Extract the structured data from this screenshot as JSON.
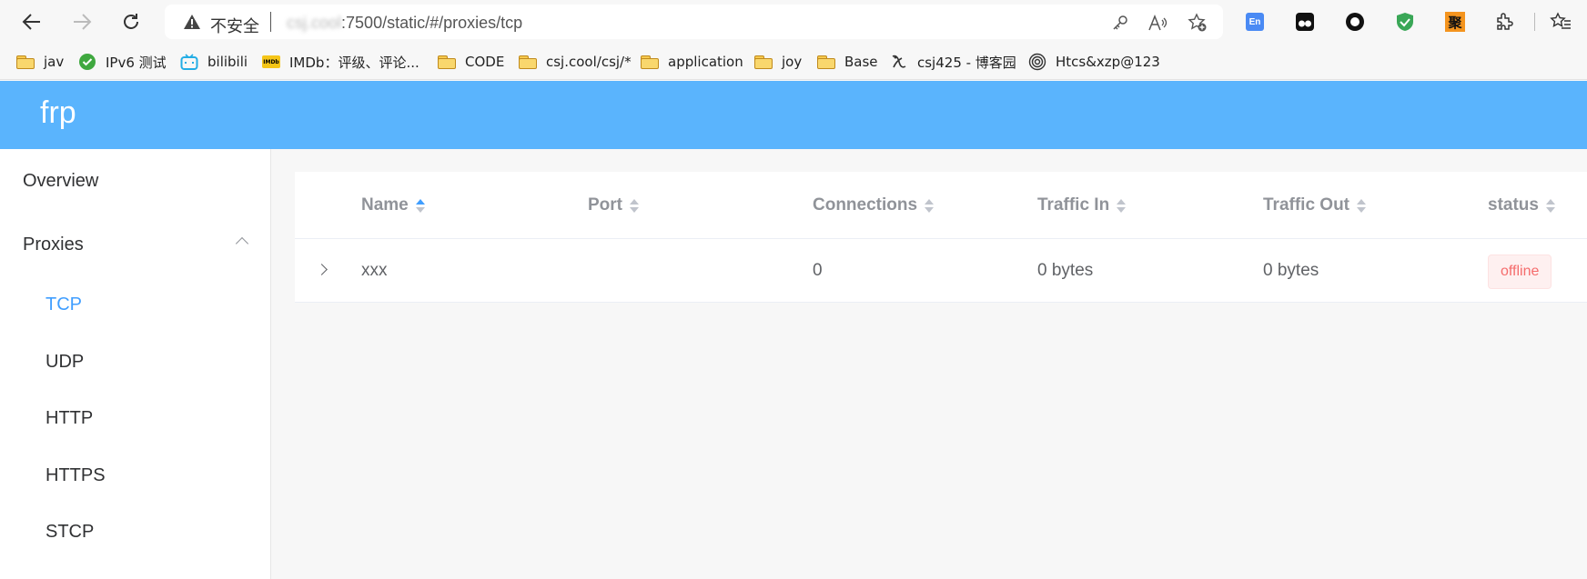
{
  "browser": {
    "security_label": "不安全",
    "url_host_obscured": "csj.cool",
    "url_rest": ":7500/static/#/proxies/tcp",
    "icons": [
      "back-icon",
      "forward-icon",
      "refresh-icon",
      "warning-icon",
      "key-icon",
      "read-aloud-icon",
      "add-favorite-icon",
      "translate-extension-icon",
      "tampermonkey-extension-icon",
      "circle-extension-icon",
      "shield-extension-icon",
      "ju-extension-icon",
      "extensions-icon",
      "favorites-icon"
    ],
    "ext_label_ju": "聚",
    "ext_label_translate": "En"
  },
  "bookmarks": [
    {
      "label": "jav",
      "icon": "folder-icon"
    },
    {
      "label": "IPv6 测试",
      "icon": "check-circle-icon"
    },
    {
      "label": "bilibili",
      "icon": "bilibili-icon"
    },
    {
      "label": "IMDb：评级、评论...",
      "icon": "imdb-icon",
      "icon_text": "IMDb"
    },
    {
      "label": "CODE",
      "icon": "folder-icon"
    },
    {
      "label": "csj.cool/csj/*",
      "icon": "folder-icon"
    },
    {
      "label": "application",
      "icon": "folder-icon"
    },
    {
      "label": "joy",
      "icon": "folder-icon"
    },
    {
      "label": "Base",
      "icon": "folder-icon"
    },
    {
      "label": "csj425 - 博客园",
      "icon": "cnblogs-icon"
    },
    {
      "label": "Htcs&xzp@123",
      "icon": "spiral-icon"
    }
  ],
  "app": {
    "title": "frp",
    "menu": {
      "overview": "Overview",
      "proxies": "Proxies",
      "sub": [
        "TCP",
        "UDP",
        "HTTP",
        "HTTPS",
        "STCP"
      ],
      "active": "TCP"
    },
    "table": {
      "columns": [
        "Name",
        "Port",
        "Connections",
        "Traffic In",
        "Traffic Out",
        "status"
      ],
      "sorted_column": "Name",
      "rows": [
        {
          "name": "xxx",
          "port": "",
          "connections": "0",
          "traffic_in": "0 bytes",
          "traffic_out": "0 bytes",
          "status": "offline"
        }
      ]
    }
  },
  "colors": {
    "header": "#5ab4fd",
    "active": "#409eff",
    "offline_text": "#f56c6c",
    "offline_bg": "#fef0f0"
  }
}
